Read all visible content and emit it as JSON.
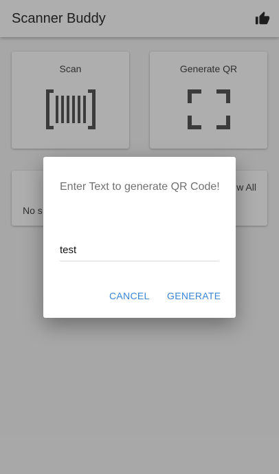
{
  "appbar": {
    "title": "Scanner Buddy",
    "like_icon": "thumbs-up-icon"
  },
  "cards": {
    "scan": {
      "label": "Scan",
      "icon": "barcode-scan-icon"
    },
    "generate": {
      "label": "Generate QR",
      "icon": "scan-frame-icon"
    },
    "recent": {
      "empty_text": "No s",
      "view_all": "w All"
    }
  },
  "dialog": {
    "message": "Enter Text to generate QR Code!",
    "input_value": "test",
    "cancel_label": "CANCEL",
    "generate_label": "GENERATE"
  },
  "colors": {
    "accent": "#3a86d8",
    "overlay": "rgba(0,0,0,0.30)"
  }
}
